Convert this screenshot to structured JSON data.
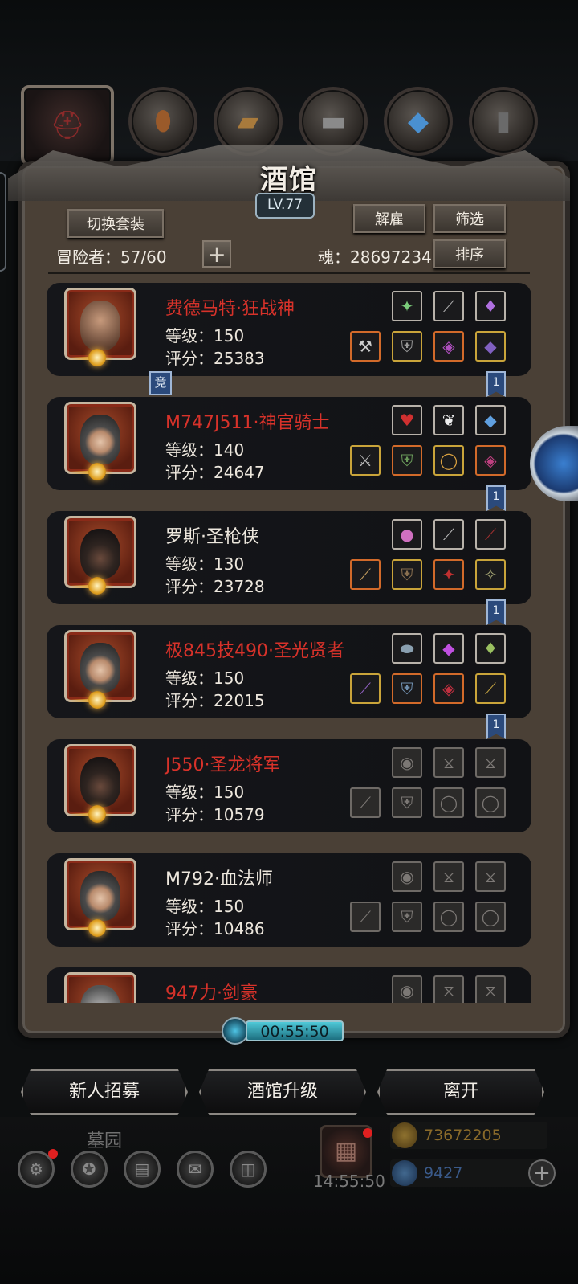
{
  "title": "酒馆",
  "level": "LV.77",
  "top_tabs": [
    {
      "icon": "helmet-icon",
      "active": true
    },
    {
      "icon": "shield-wood-icon",
      "active": false
    },
    {
      "icon": "wooden-planks-icon",
      "active": false
    },
    {
      "icon": "anvil-icon",
      "active": false
    },
    {
      "icon": "blue-crystal-icon",
      "active": false
    },
    {
      "icon": "iron-bars-icon",
      "active": false
    }
  ],
  "buttons": {
    "switch_outfit": "切换套装",
    "dismiss": "解雇",
    "filter": "筛选",
    "sort": "排序",
    "recruit": "新人招募",
    "upgrade": "酒馆升级",
    "leave": "离开"
  },
  "adventurers_label": "冒险者：57/60",
  "soul_label": "魂：28697234",
  "competitive_tag": "竞",
  "characters": [
    {
      "name": "费德马特·狂战神",
      "name_color": "red",
      "level": "等级：150",
      "score": "评分：25383",
      "portrait": "barbarian",
      "flag": "1"
    },
    {
      "name": "M747J511·神官骑士",
      "name_color": "red",
      "level": "等级：140",
      "score": "评分：24647",
      "portrait": "hooded-priestess",
      "flag": "1"
    },
    {
      "name": "罗斯·圣枪侠",
      "name_color": "white",
      "level": "等级：130",
      "score": "评分：23728",
      "portrait": "gunslinger",
      "flag": "1"
    },
    {
      "name": "极845技490·圣光贤者",
      "name_color": "red",
      "level": "等级：150",
      "score": "评分：22015",
      "portrait": "hooded-priestess",
      "flag": "1"
    },
    {
      "name": "J550·圣龙将军",
      "name_color": "red",
      "level": "等级：150",
      "score": "评分：10579",
      "portrait": "dark-haired-general",
      "flag": ""
    },
    {
      "name": "M792·血法师",
      "name_color": "white",
      "level": "等级：150",
      "score": "评分：10486",
      "portrait": "hooded-mage",
      "flag": ""
    },
    {
      "name": "947力·剑豪",
      "name_color": "red",
      "level": "",
      "score": "",
      "portrait": "armored-swordsman",
      "flag": ""
    }
  ],
  "timer": "00:55:50",
  "bottom": {
    "graveyard": "墓园",
    "gift_timer": "14:55:50",
    "gold": "73672205",
    "gems": "9427"
  },
  "colors": {
    "red_name": "#d7322a",
    "panel_bg": "#4a4036",
    "timer_bar": "#4fc9d8"
  }
}
